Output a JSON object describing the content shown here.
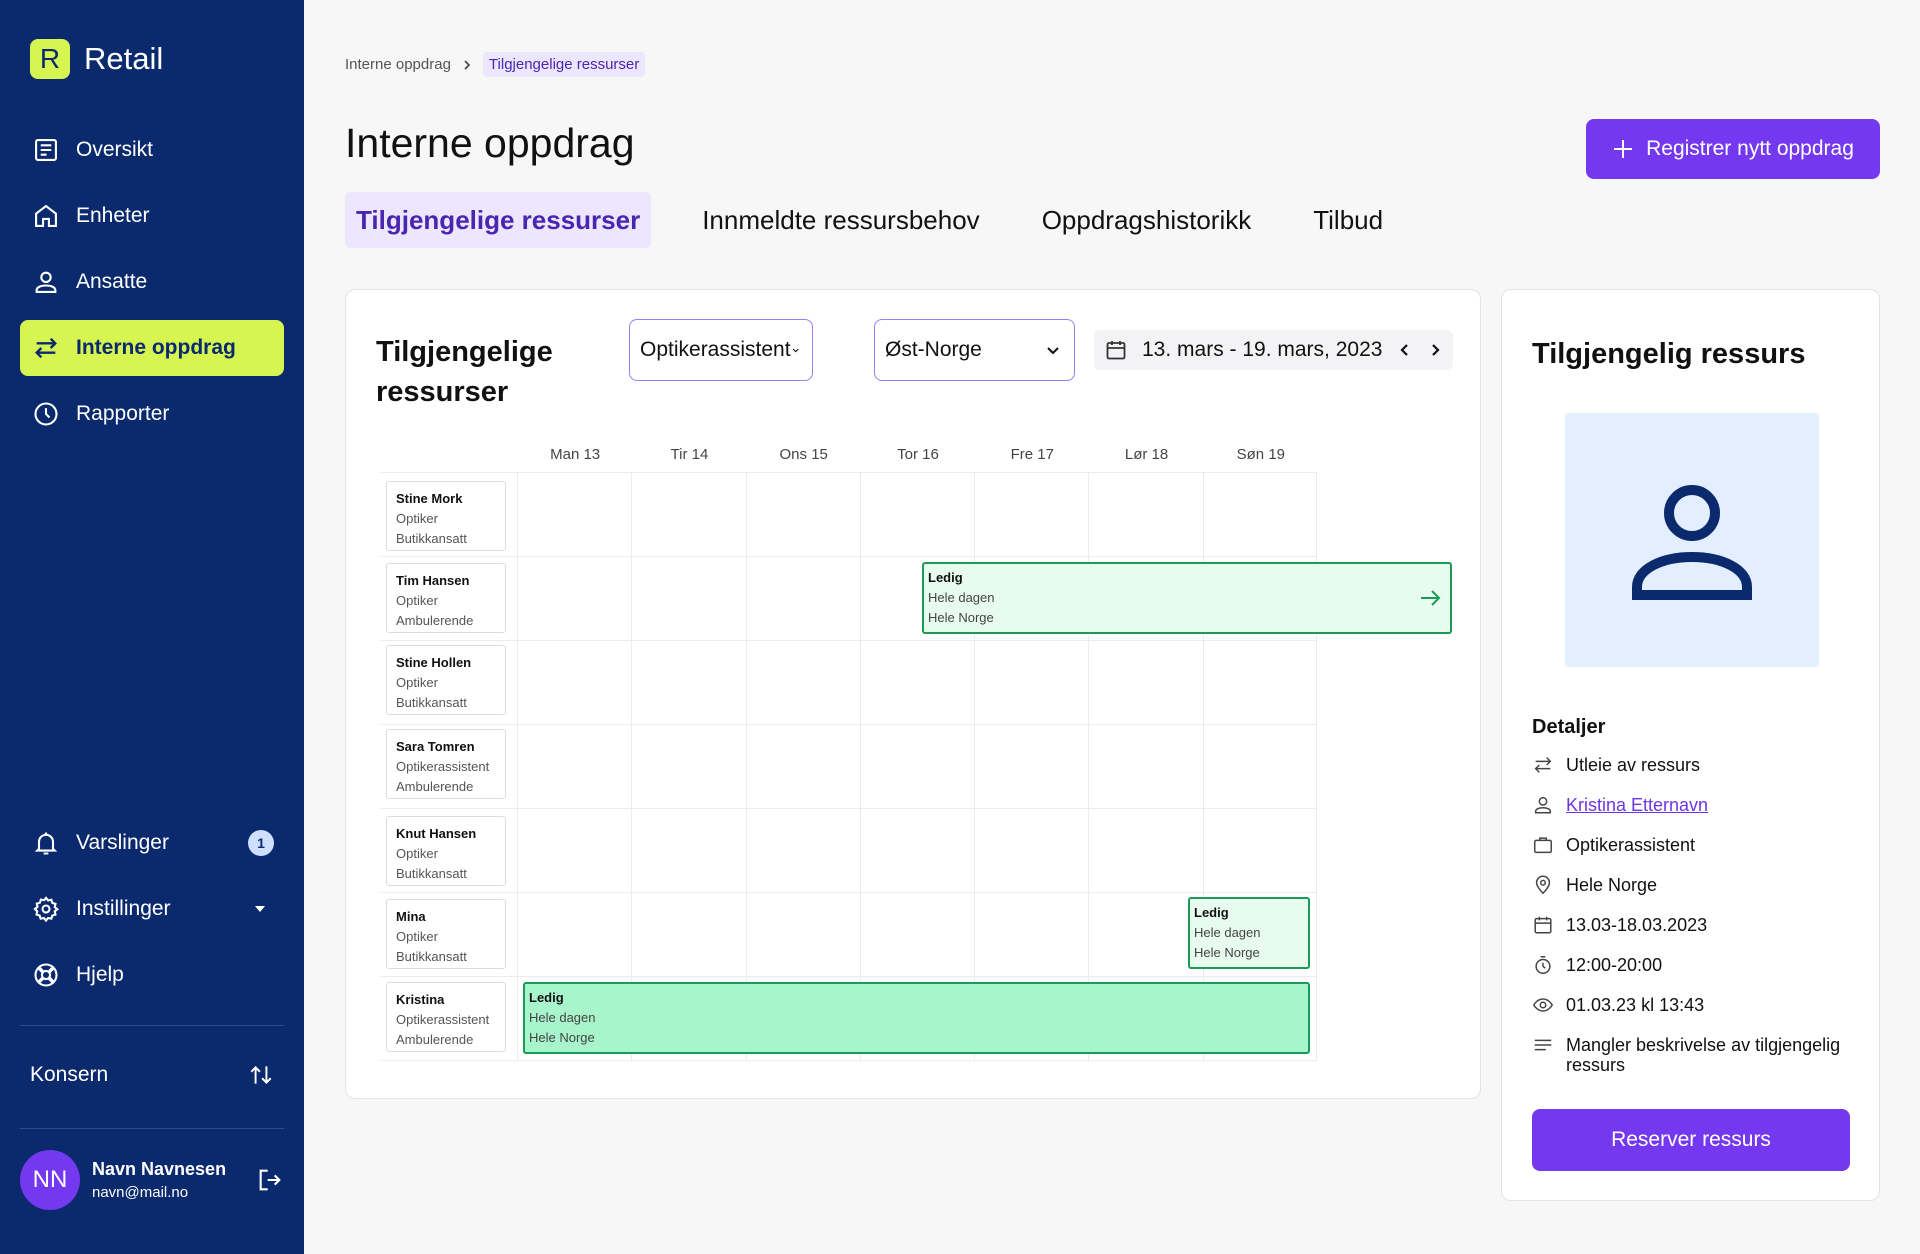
{
  "app": {
    "badge": "R",
    "name": "Retail"
  },
  "sidebar": {
    "items": [
      {
        "label": "Oversikt",
        "icon": "document-icon"
      },
      {
        "label": "Enheter",
        "icon": "home-icon"
      },
      {
        "label": "Ansatte",
        "icon": "user-icon"
      },
      {
        "label": "Interne oppdrag",
        "icon": "swap-arrows-icon",
        "active": true
      },
      {
        "label": "Rapporter",
        "icon": "clock-icon"
      }
    ],
    "bottom_items": [
      {
        "label": "Varslinger",
        "icon": "bell-icon",
        "badge": "1"
      },
      {
        "label": "Instillinger",
        "icon": "gear-icon"
      },
      {
        "label": "Hjelp",
        "icon": "lifebuoy-icon"
      }
    ],
    "konsern": "Konsern",
    "user": {
      "initials": "NN",
      "name": "Navn Navnesen",
      "email": "navn@mail.no"
    }
  },
  "breadcrumb": {
    "parent": "Interne oppdrag",
    "current": "Tilgjengelige ressurser"
  },
  "page": {
    "title": "Interne oppdrag",
    "new_button": "Registrer nytt oppdrag"
  },
  "tabs": [
    {
      "label": "Tilgjengelige ressurser",
      "active": true
    },
    {
      "label": "Innmeldte ressursbehov"
    },
    {
      "label": "Oppdragshistorikk"
    },
    {
      "label": "Tilbud"
    }
  ],
  "calendar": {
    "title": "Tilgjengelige ressurser",
    "role_filter": "Optikerassistent",
    "region_filter": "Øst-Norge",
    "date_range": "13. mars - 19. mars, 2023",
    "days": [
      "Man 13",
      "Tir 14",
      "Ons 15",
      "Tor 16",
      "Fre 17",
      "Lør 18",
      "Søn 19"
    ],
    "people": [
      {
        "name": "Stine Mork",
        "role": "Optiker",
        "type": "Butikkansatt"
      },
      {
        "name": "Tim Hansen",
        "role": "Optiker",
        "type": "Ambulerende"
      },
      {
        "name": "Stine Hollen",
        "role": "Optiker",
        "type": "Butikkansatt"
      },
      {
        "name": "Sara Tomren",
        "role": "Optikerassistent",
        "type": "Ambulerende"
      },
      {
        "name": "Knut Hansen",
        "role": "Optiker",
        "type": "Butikkansatt"
      },
      {
        "name": "Mina",
        "role": "Optiker",
        "type": "Butikkansatt"
      },
      {
        "name": "Kristina",
        "role": "Optikerassistent",
        "type": "Ambulerende"
      }
    ],
    "events": [
      {
        "status": "Ledig",
        "time": "Hele dagen",
        "area": "Hele Norge"
      },
      {
        "status": "Ledig",
        "time": "Hele dagen",
        "area": "Hele Norge"
      },
      {
        "status": "Ledig",
        "time": "Hele dagen",
        "area": "Hele Norge"
      }
    ]
  },
  "detail": {
    "title": "Tilgjengelig ressurs",
    "heading": "Detaljer",
    "items": {
      "type": "Utleie av ressurs",
      "person": "Kristina Etternavn",
      "role": "Optikerassistent",
      "area": "Hele Norge",
      "dates": "13.03-18.03.2023",
      "hours": "12:00-20:00",
      "seen": "01.03.23 kl 13:43",
      "description": "Mangler beskrivelse av tilgjengelig ressurs"
    },
    "reserve_button": "Reserver ressurs"
  },
  "colors": {
    "sidebar": "#0b2a6e",
    "accent": "#7438f0",
    "highlight": "#d7f550",
    "available": "#1d9a55"
  }
}
